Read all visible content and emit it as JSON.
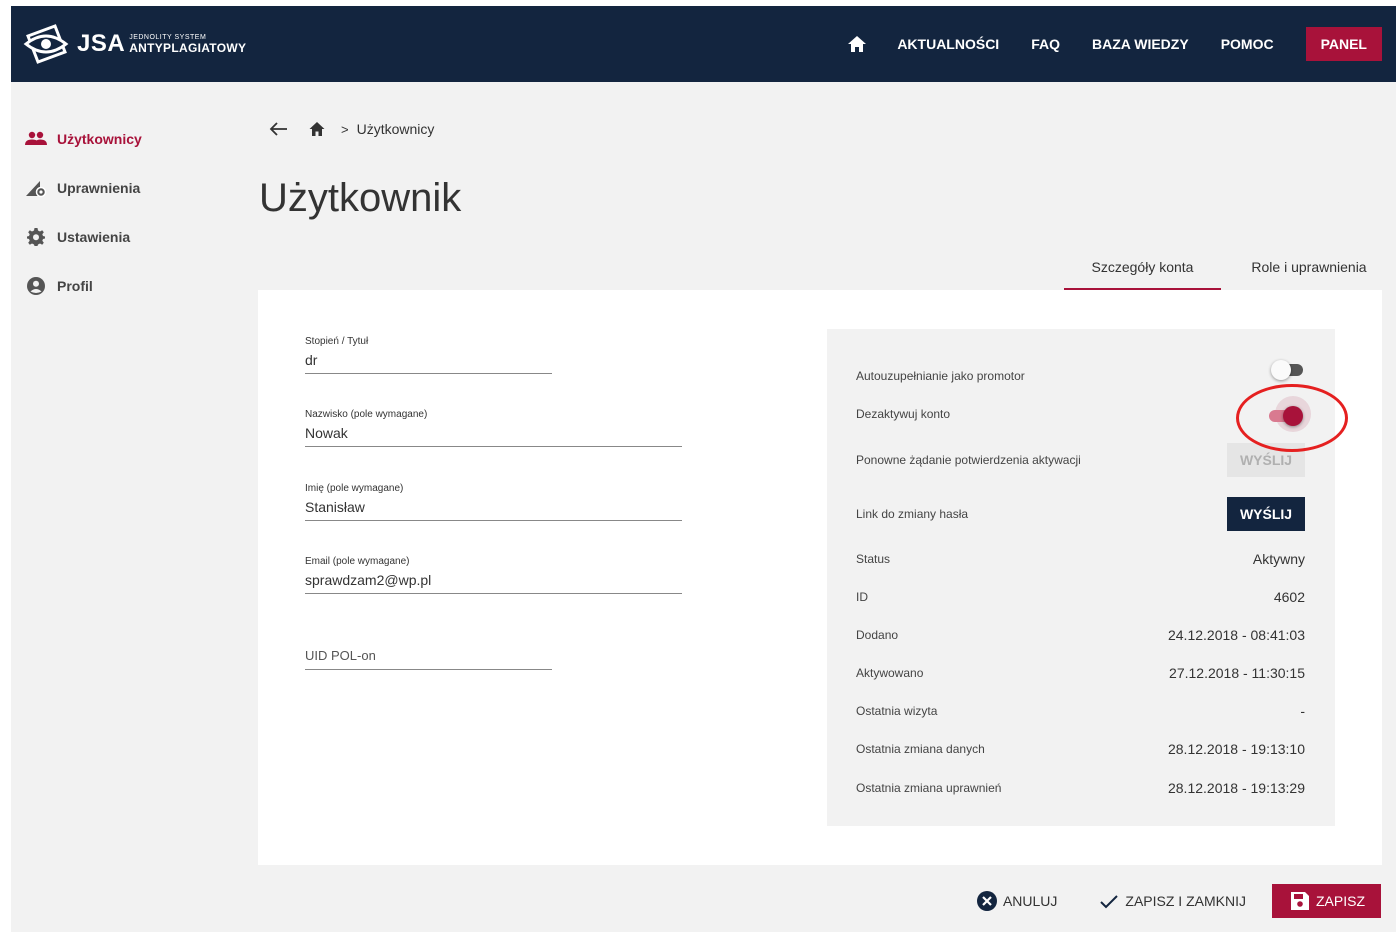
{
  "header": {
    "logo_text": "JSA",
    "logo_sub_line1": "JEDNOLITY SYSTEM",
    "logo_sub_line2": "ANTYPLAGIATOWY",
    "nav": [
      "AKTUALNOŚCI",
      "FAQ",
      "BAZA WIEDZY",
      "POMOC"
    ],
    "panel_label": "PANEL"
  },
  "sidebar": {
    "items": [
      {
        "label": "Użytkownicy",
        "icon": "users-icon",
        "active": true
      },
      {
        "label": "Uprawnienia",
        "icon": "permissions-icon",
        "active": false
      },
      {
        "label": "Ustawienia",
        "icon": "gear-icon",
        "active": false
      },
      {
        "label": "Profil",
        "icon": "account-icon",
        "active": false
      }
    ]
  },
  "breadcrumb": {
    "separator": ">",
    "current": "Użytkownicy"
  },
  "page": {
    "title": "Użytkownik"
  },
  "tabs": [
    {
      "label": "Szczegóły konta",
      "active": true
    },
    {
      "label": "Role i uprawnienia",
      "active": false
    }
  ],
  "form": {
    "title_label": "Stopień / Tytuł",
    "title_value": "dr",
    "surname_label": "Nazwisko (pole wymagane)",
    "surname_value": "Nowak",
    "name_label": "Imię (pole wymagane)",
    "name_value": "Stanisław",
    "email_label": "Email (pole wymagane)",
    "email_value": "sprawdzam2@wp.pl",
    "uid_placeholder": "UID POL-on"
  },
  "account": {
    "autofill_label": "Autouzupełnianie jako promotor",
    "autofill_on": false,
    "deactivate_label": "Dezaktywuj konto",
    "deactivate_on": true,
    "resend_label": "Ponowne żądanie potwierdzenia aktywacji",
    "resend_button": "WYŚLIJ",
    "password_link_label": "Link do zmiany hasła",
    "password_link_button": "WYŚLIJ",
    "status_label": "Status",
    "status_value": "Aktywny",
    "id_label": "ID",
    "id_value": "4602",
    "added_label": "Dodano",
    "added_value": "24.12.2018 - 08:41:03",
    "activated_label": "Aktywowano",
    "activated_value": "27.12.2018 - 11:30:15",
    "last_visit_label": "Ostatnia wizyta",
    "last_visit_value": "-",
    "last_data_change_label": "Ostatnia zmiana danych",
    "last_data_change_value": "28.12.2018 - 19:13:10",
    "last_perm_change_label": "Ostatnia zmiana uprawnień",
    "last_perm_change_value": "28.12.2018 - 19:13:29"
  },
  "actions": {
    "cancel": "ANULUJ",
    "save_close": "ZAPISZ I ZAMKNIJ",
    "save": "ZAPISZ"
  },
  "colors": {
    "navy": "#13253f",
    "accent": "#a8123a",
    "highlight": "#e52020"
  }
}
